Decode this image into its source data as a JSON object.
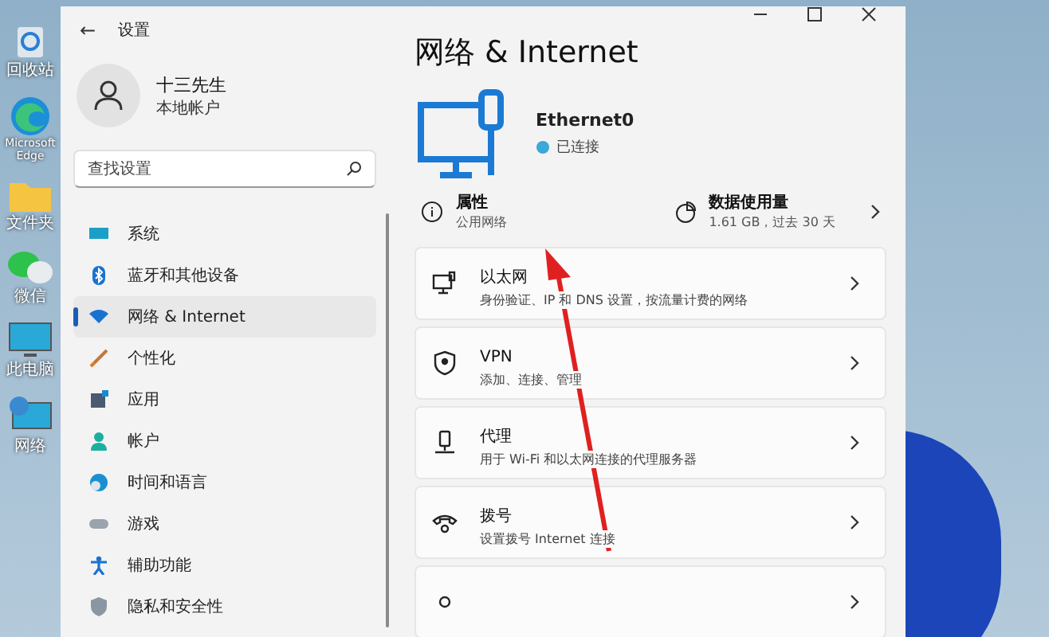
{
  "desktop_icons": [
    {
      "kind": "recycle",
      "label": "回收站"
    },
    {
      "kind": "edge",
      "label": "Microsoft Edge"
    },
    {
      "kind": "folder",
      "label": "文件夹"
    },
    {
      "kind": "wechat",
      "label": "微信"
    },
    {
      "kind": "pc",
      "label": "此电脑"
    },
    {
      "kind": "network",
      "label": "网络"
    }
  ],
  "window": {
    "back": "←",
    "title": "设置"
  },
  "profile": {
    "name": "十三先生",
    "account": "本地帐户"
  },
  "search": {
    "placeholder": "查找设置"
  },
  "sidebar": {
    "items": [
      {
        "kind": "system",
        "label": "系统",
        "selected": false
      },
      {
        "kind": "bluetooth",
        "label": "蓝牙和其他设备",
        "selected": false
      },
      {
        "kind": "network",
        "label": "网络 & Internet",
        "selected": true
      },
      {
        "kind": "brush",
        "label": "个性化",
        "selected": false
      },
      {
        "kind": "apps",
        "label": "应用",
        "selected": false
      },
      {
        "kind": "account",
        "label": "帐户",
        "selected": false
      },
      {
        "kind": "time",
        "label": "时间和语言",
        "selected": false
      },
      {
        "kind": "game",
        "label": "游戏",
        "selected": false
      },
      {
        "kind": "access",
        "label": "辅助功能",
        "selected": false
      },
      {
        "kind": "privacy",
        "label": "隐私和安全性",
        "selected": false
      }
    ]
  },
  "page": {
    "title": "网络 & Internet",
    "adapter": {
      "name": "Ethernet0",
      "status": "已连接"
    },
    "properties": {
      "title": "属性",
      "subtitle": "公用网络"
    },
    "data_usage": {
      "title": "数据使用量",
      "subtitle": "1.61 GB，过去 30 天"
    },
    "cards": [
      {
        "kind": "ethernet",
        "title": "以太网",
        "subtitle": "身份验证、IP 和 DNS 设置，按流量计费的网络"
      },
      {
        "kind": "vpn",
        "title": "VPN",
        "subtitle": "添加、连接、管理"
      },
      {
        "kind": "proxy",
        "title": "代理",
        "subtitle": "用于 Wi-Fi 和以太网连接的代理服务器"
      },
      {
        "kind": "dialup",
        "title": "拨号",
        "subtitle": "设置拨号 Internet 连接"
      },
      {
        "kind": "advanced"
      }
    ]
  }
}
